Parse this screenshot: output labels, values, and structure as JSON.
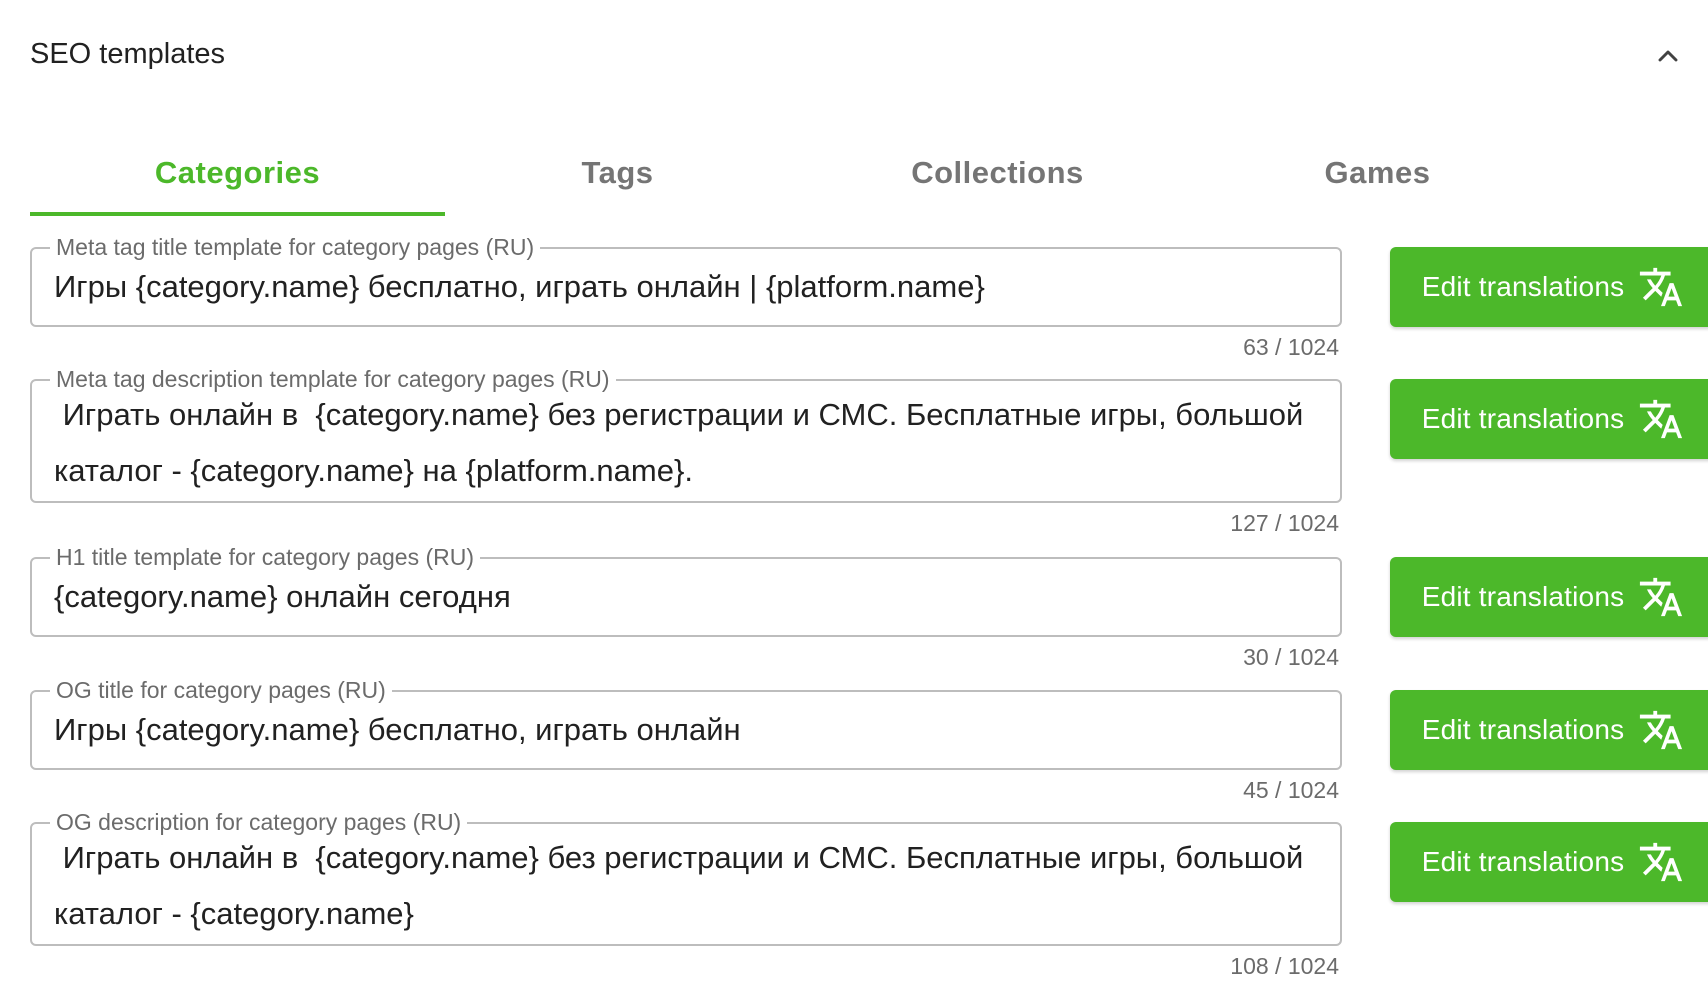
{
  "panel": {
    "title": "SEO templates",
    "collapse_icon": "chevron-up-icon"
  },
  "tabs": [
    {
      "label": "Categories",
      "active": true
    },
    {
      "label": "Tags",
      "active": false
    },
    {
      "label": "Collections",
      "active": false
    },
    {
      "label": "Games",
      "active": false
    }
  ],
  "colors": {
    "accent": "#4cb82a",
    "border": "#bdbdbd",
    "inactive_tab": "#757575"
  },
  "fields": [
    {
      "label": "Meta tag title template for category pages (RU)",
      "value": "Игры {category.name} бесплатно, играть онлайн | {platform.name}",
      "counter": "63 / 1024",
      "button_label": "Edit translations",
      "button_icon": "translate-icon"
    },
    {
      "label": "Meta tag description template for category pages (RU)",
      "value": " Играть онлайн в  {category.name} без регистрации и СМС. Бесплатные игры, большой каталог - {category.name} на {platform.name}.",
      "counter": "127 / 1024",
      "button_label": "Edit translations",
      "button_icon": "translate-icon"
    },
    {
      "label": "H1 title template for category pages (RU)",
      "value": "{category.name} онлайн сегодня",
      "counter": "30 / 1024",
      "button_label": "Edit translations",
      "button_icon": "translate-icon"
    },
    {
      "label": "OG title for category pages (RU)",
      "value": "Игры {category.name} бесплатно, играть онлайн",
      "counter": "45 / 1024",
      "button_label": "Edit translations",
      "button_icon": "translate-icon"
    },
    {
      "label": "OG description for category pages (RU)",
      "value": " Играть онлайн в  {category.name} без регистрации и СМС. Бесплатные игры, большой каталог - {category.name}",
      "counter": "108 / 1024",
      "button_label": "Edit translations",
      "button_icon": "translate-icon"
    }
  ]
}
